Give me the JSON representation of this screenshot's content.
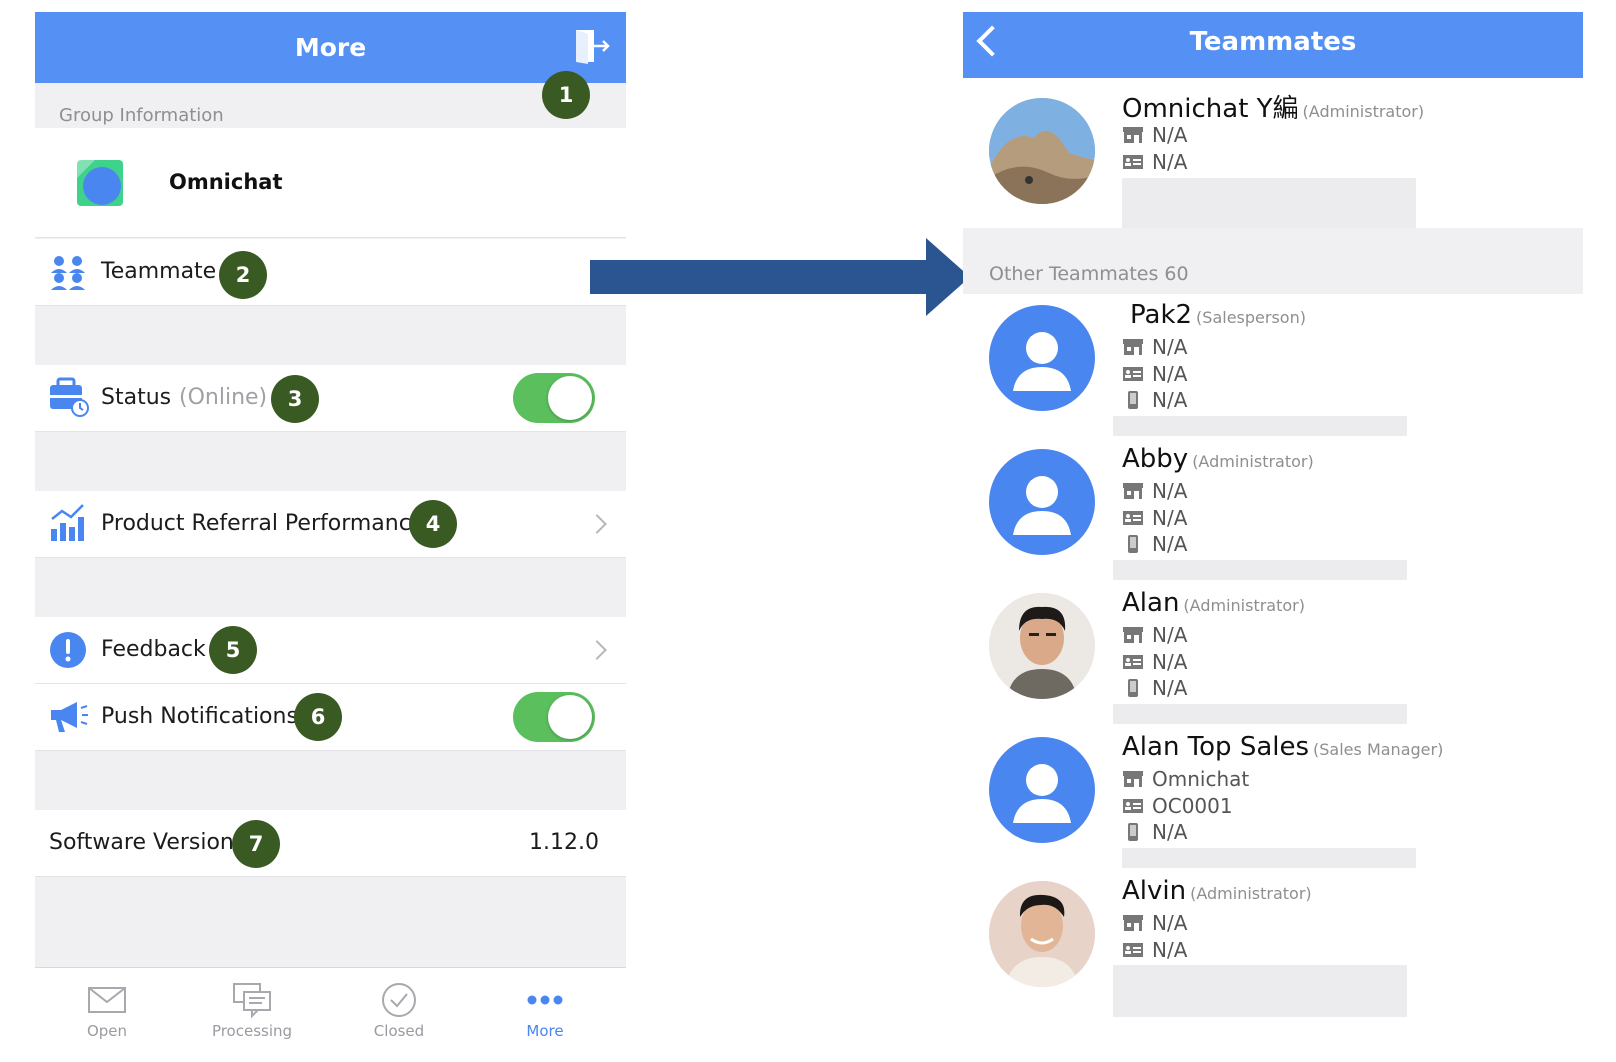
{
  "left": {
    "header": {
      "title": "More",
      "exit_icon": "exit-door-icon"
    },
    "group_info_label": "Group Information",
    "group": {
      "name": "Omnichat",
      "logo": "omnichat-logo"
    },
    "teammate_label": "Teammate",
    "status": {
      "label": "Status",
      "value": "(Online)",
      "toggle_on": true
    },
    "product_referral_label": "Product Referral Performance",
    "feedback_label": "Feedback",
    "push": {
      "label": "Push Notifications",
      "toggle_on": true
    },
    "software_version": {
      "label": "Software Version",
      "value": "1.12.0"
    },
    "badges": [
      "1",
      "2",
      "3",
      "4",
      "5",
      "6",
      "7"
    ],
    "tabs": [
      {
        "label": "Open",
        "icon": "envelope-icon"
      },
      {
        "label": "Processing",
        "icon": "chat-bubbles-icon"
      },
      {
        "label": "Closed",
        "icon": "check-circle-icon"
      },
      {
        "label": "More",
        "icon": "more-dots-icon",
        "active": true
      }
    ],
    "accent": "#5590f4",
    "toggle_color": "#5bbf5d",
    "badge_color": "#3a5a23"
  },
  "right": {
    "header": {
      "title": "Teammates"
    },
    "me": {
      "name": "Omnichat Y編",
      "role": "(Administrator)",
      "store": "N/A",
      "id": "N/A"
    },
    "other_label": "Other Teammates 60",
    "teammates": [
      {
        "name": "Pak2",
        "role": "(Salesperson)",
        "store": "N/A",
        "id": "N/A",
        "phone": "N/A"
      },
      {
        "name": "Abby",
        "role": "(Administrator)",
        "store": "N/A",
        "id": "N/A",
        "phone": "N/A"
      },
      {
        "name": "Alan",
        "role": "(Administrator)",
        "store": "N/A",
        "id": "N/A",
        "phone": "N/A"
      },
      {
        "name": "Alan Top Sales",
        "role": "(Sales Manager)",
        "store": "Omnichat",
        "id": "OC0001",
        "phone": "N/A"
      },
      {
        "name": "Alvin",
        "role": "(Administrator)",
        "store": "N/A",
        "id": "N/A"
      }
    ]
  }
}
